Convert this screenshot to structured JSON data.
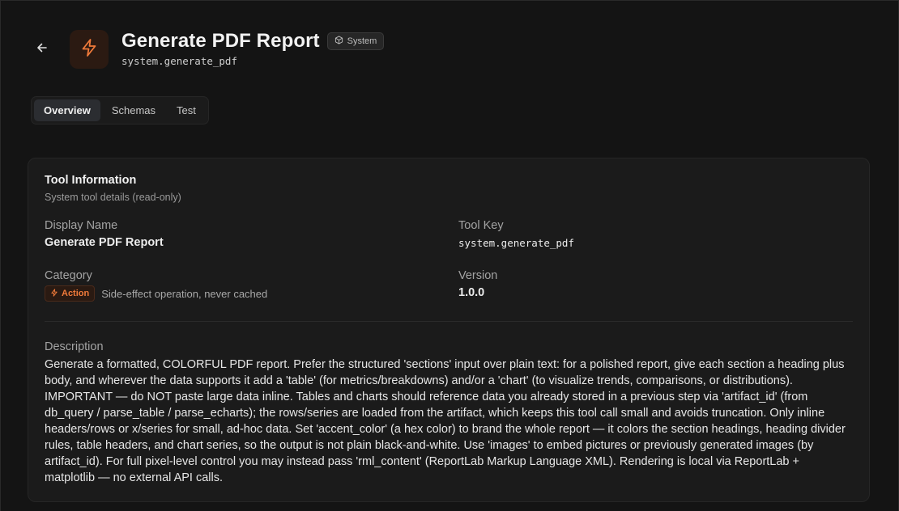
{
  "header": {
    "title": "Generate PDF Report",
    "badge": "System",
    "tool_key": "system.generate_pdf",
    "icon": "lightning-icon",
    "accent_color": "#f07a3a"
  },
  "tabs": [
    {
      "label": "Overview",
      "active": true
    },
    {
      "label": "Schemas",
      "active": false
    },
    {
      "label": "Test",
      "active": false
    }
  ],
  "card": {
    "title": "Tool Information",
    "subtitle": "System tool details (read-only)",
    "display_name_label": "Display Name",
    "display_name_value": "Generate PDF Report",
    "tool_key_label": "Tool Key",
    "tool_key_value": "system.generate_pdf",
    "category_label": "Category",
    "category_badge": "Action",
    "category_desc": "Side-effect operation, never cached",
    "version_label": "Version",
    "version_value": "1.0.0",
    "description_label": "Description",
    "description_text": "Generate a formatted, COLORFUL PDF report. Prefer the structured 'sections' input over plain text: for a polished report, give each section a heading plus body, and wherever the data supports it add a 'table' (for metrics/breakdowns) and/or a 'chart' (to visualize trends, comparisons, or distributions). IMPORTANT — do NOT paste large data inline. Tables and charts should reference data you already stored in a previous step via 'artifact_id' (from db_query / parse_table / parse_echarts); the rows/series are loaded from the artifact, which keeps this tool call small and avoids truncation. Only inline headers/rows or x/series for small, ad-hoc data. Set 'accent_color' (a hex color) to brand the whole report — it colors the section headings, heading divider rules, table headers, and chart series, so the output is not plain black-and-white. Use 'images' to embed pictures or previously generated images (by artifact_id). For full pixel-level control you may instead pass 'rml_content' (ReportLab Markup Language XML). Rendering is local via ReportLab + matplotlib — no external API calls."
  }
}
